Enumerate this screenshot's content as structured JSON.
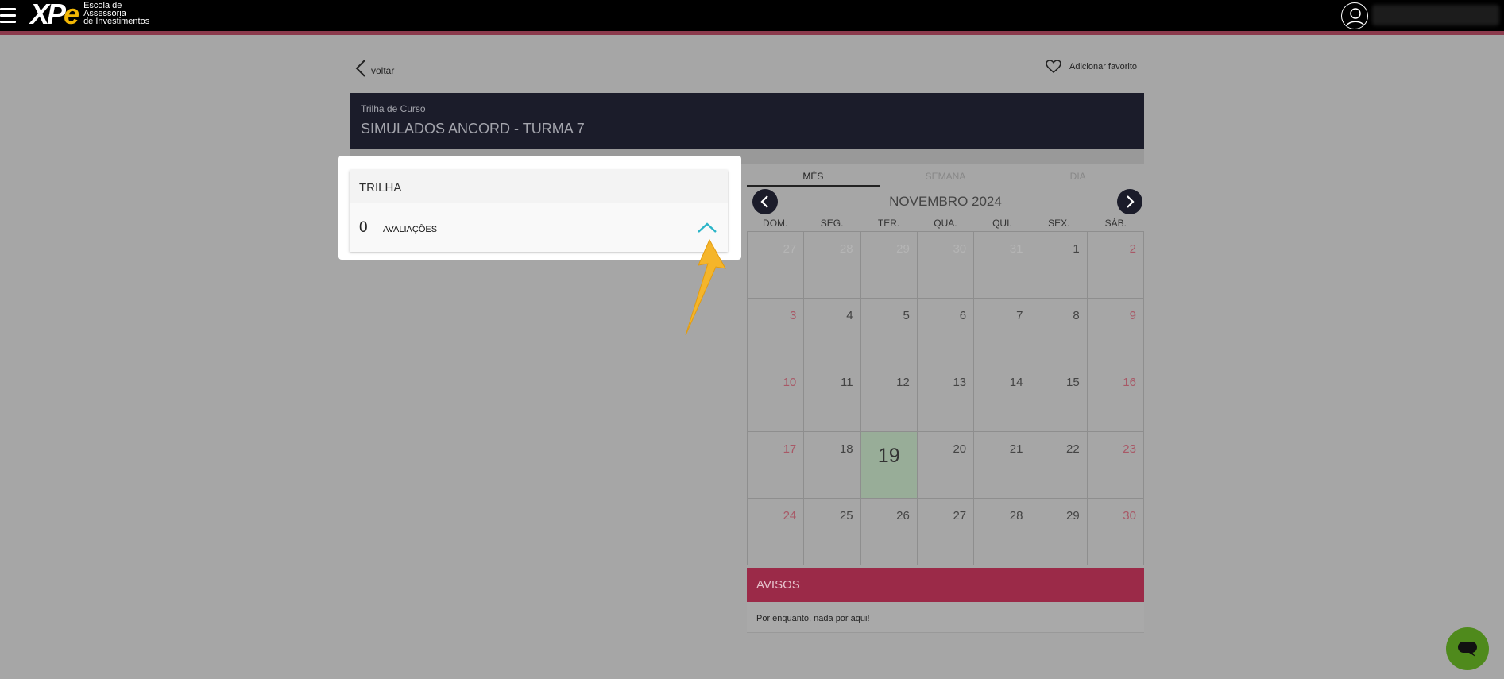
{
  "topbar": {
    "logo_letters_a": "XP",
    "logo_letters_b": "e",
    "logo_sub_1": "Escola de",
    "logo_sub_2": "Assessoria",
    "logo_sub_3": "de Investimentos"
  },
  "nav": {
    "back_label": "voltar",
    "favorite_label": "Adicionar favorito"
  },
  "course": {
    "subtitle": "Trilha de Curso",
    "title": "SIMULADOS ANCORD - TURMA 7"
  },
  "trilha": {
    "heading": "TRILHA",
    "count": "0",
    "label": "AVALIAÇÕES"
  },
  "calendar": {
    "tabs": [
      "MÊS",
      "SEMANA",
      "DIA"
    ],
    "active_tab": "MÊS",
    "month_label": "NOVEMBRO 2024",
    "weekdays": [
      "DOM.",
      "SEG.",
      "TER.",
      "QUA.",
      "QUI.",
      "SEX.",
      "SÁB."
    ],
    "days": [
      "27",
      "28",
      "29",
      "30",
      "31",
      "1",
      "2",
      "3",
      "4",
      "5",
      "6",
      "7",
      "8",
      "9",
      "10",
      "11",
      "12",
      "13",
      "14",
      "15",
      "16",
      "17",
      "18",
      "19",
      "20",
      "21",
      "22",
      "23",
      "24",
      "25",
      "26",
      "27",
      "28",
      "29",
      "30"
    ],
    "today": "19"
  },
  "avisos": {
    "heading": "AVISOS",
    "empty_text": "Por enquanto, nada por aqui!"
  },
  "colors": {
    "header_bg": "#1b1c2a",
    "avisos_bg": "#9b2a48",
    "accent_teal": "#2bb5c8",
    "chat_green": "#4f8a1c",
    "annotation_arrow": "#f5b52a"
  },
  "icons": {
    "menu": "hamburger-icon",
    "user": "user-avatar-icon",
    "back": "chevron-left-icon",
    "favorite": "heart-icon",
    "expand": "chevron-up-icon",
    "prev": "arrow-left-icon",
    "next": "arrow-right-icon",
    "chat": "chat-bubble-icon"
  }
}
